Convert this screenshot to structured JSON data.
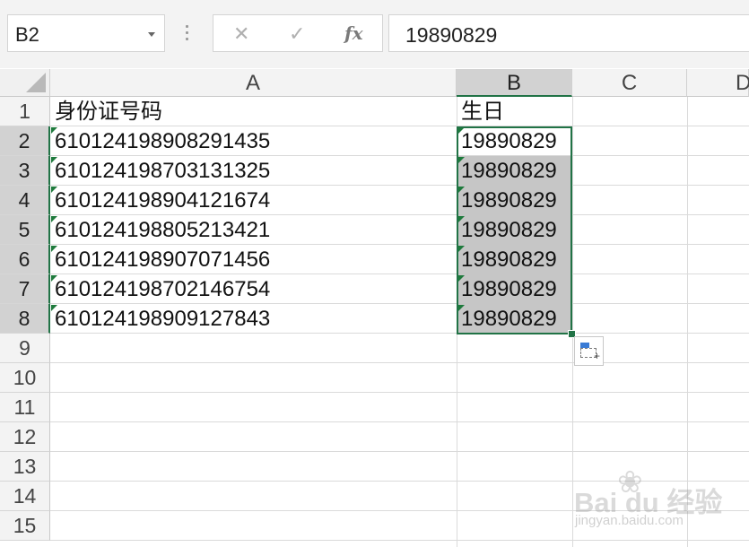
{
  "name_box": {
    "value": "B2"
  },
  "formula_bar": {
    "cancel_icon": "✕",
    "enter_icon": "✓",
    "function_label": "fx",
    "value": "19890829"
  },
  "columns": [
    "A",
    "B",
    "C",
    "D"
  ],
  "rows": [
    {
      "num": "1",
      "a": "身份证号码",
      "b": "生日"
    },
    {
      "num": "2",
      "a": "610124198908291435",
      "b": "19890829"
    },
    {
      "num": "3",
      "a": "610124198703131325",
      "b": "19890829"
    },
    {
      "num": "4",
      "a": "610124198904121674",
      "b": "19890829"
    },
    {
      "num": "5",
      "a": "610124198805213421",
      "b": "19890829"
    },
    {
      "num": "6",
      "a": "610124198907071456",
      "b": "19890829"
    },
    {
      "num": "7",
      "a": "610124198702146754",
      "b": "19890829"
    },
    {
      "num": "8",
      "a": "610124198909127843",
      "b": "19890829"
    },
    {
      "num": "9",
      "a": "",
      "b": ""
    },
    {
      "num": "10",
      "a": "",
      "b": ""
    },
    {
      "num": "11",
      "a": "",
      "b": ""
    },
    {
      "num": "12",
      "a": "",
      "b": ""
    },
    {
      "num": "13",
      "a": "",
      "b": ""
    },
    {
      "num": "14",
      "a": "",
      "b": ""
    },
    {
      "num": "15",
      "a": "",
      "b": ""
    }
  ],
  "selection": {
    "active_cell": "B2",
    "range": "B2:B8"
  },
  "colors": {
    "accent": "#217346",
    "selected_fill": "#c6c6c6",
    "text_marker": "#1e7a3c"
  },
  "watermark": {
    "brand": "Bai du 经验",
    "url": "jingyan.baidu.com",
    "paw_icon": "paw-icon"
  }
}
